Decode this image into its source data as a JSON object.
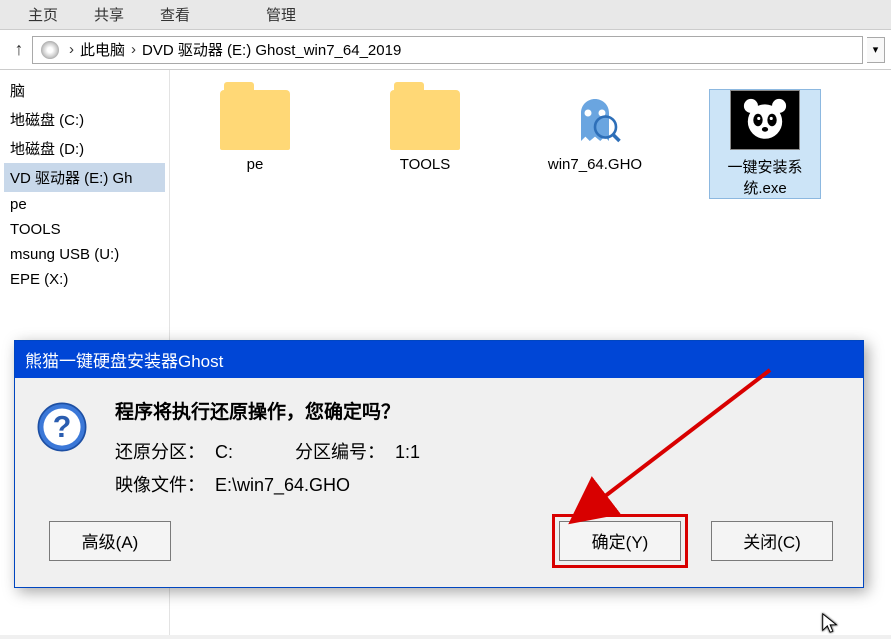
{
  "menu": {
    "home": "主页",
    "share": "共享",
    "view": "查看",
    "manage": "管理"
  },
  "breadcrumb": {
    "thispc": "此电脑",
    "drive": "DVD 驱动器 (E:) Ghost_win7_64_2019"
  },
  "sidebar": {
    "items": [
      {
        "label": "脑"
      },
      {
        "label": "地磁盘 (C:)"
      },
      {
        "label": "地磁盘 (D:)"
      },
      {
        "label": "VD 驱动器 (E:) Gh",
        "selected": true
      },
      {
        "label": "pe"
      },
      {
        "label": "TOOLS"
      },
      {
        "label": "msung USB (U:)"
      },
      {
        "label": "EPE (X:)"
      }
    ]
  },
  "files": {
    "items": [
      {
        "name": "pe",
        "kind": "folder"
      },
      {
        "name": "TOOLS",
        "kind": "folder"
      },
      {
        "name": "win7_64.GHO",
        "kind": "ghost"
      },
      {
        "name": "一键安装系统.exe",
        "kind": "panda",
        "selected": true
      }
    ]
  },
  "dialog": {
    "title": "熊猫一键硬盘安装器Ghost",
    "message": "程序将执行还原操作，您确定吗？",
    "row1_label": "还原分区：",
    "row1_value": "C:",
    "row1_label2": "分区编号：",
    "row1_value2": "1:1",
    "row2_label": "映像文件：",
    "row2_value": "E:\\win7_64.GHO",
    "btn_advanced": "高级(A)",
    "btn_ok": "确定(Y)",
    "btn_close": "关闭(C)"
  }
}
